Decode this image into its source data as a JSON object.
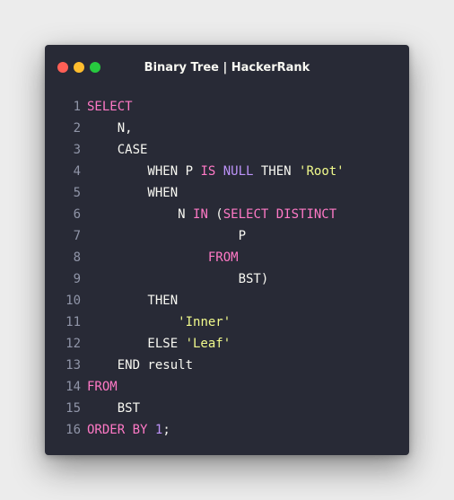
{
  "window": {
    "title": "Binary Tree | HackerRank",
    "colors": {
      "background": "#282a36",
      "keyword": "#ff79c6",
      "constant": "#bd93f9",
      "string": "#f1fa8c",
      "text": "#f8f8f2",
      "line_number": "#9095a8",
      "close": "#ff5f56",
      "minimize": "#ffbd2e",
      "maximize": "#27c93f"
    }
  },
  "code": {
    "lines": [
      {
        "n": "1",
        "tokens": [
          {
            "t": "SELECT",
            "k": "kw"
          }
        ]
      },
      {
        "n": "2",
        "tokens": [
          {
            "t": "    N,",
            "k": "plain"
          }
        ]
      },
      {
        "n": "3",
        "tokens": [
          {
            "t": "    CASE",
            "k": "plain"
          }
        ]
      },
      {
        "n": "4",
        "tokens": [
          {
            "t": "        WHEN P ",
            "k": "plain"
          },
          {
            "t": "IS",
            "k": "kw"
          },
          {
            "t": " ",
            "k": "plain"
          },
          {
            "t": "NULL",
            "k": "const"
          },
          {
            "t": " THEN ",
            "k": "plain"
          },
          {
            "t": "'Root'",
            "k": "str"
          }
        ]
      },
      {
        "n": "5",
        "tokens": [
          {
            "t": "        WHEN",
            "k": "plain"
          }
        ]
      },
      {
        "n": "6",
        "tokens": [
          {
            "t": "            N ",
            "k": "plain"
          },
          {
            "t": "IN",
            "k": "kw"
          },
          {
            "t": " (",
            "k": "plain"
          },
          {
            "t": "SELECT DISTINCT",
            "k": "kw"
          }
        ]
      },
      {
        "n": "7",
        "tokens": [
          {
            "t": "                    P",
            "k": "plain"
          }
        ]
      },
      {
        "n": "8",
        "tokens": [
          {
            "t": "                ",
            "k": "plain"
          },
          {
            "t": "FROM",
            "k": "kw"
          }
        ]
      },
      {
        "n": "9",
        "tokens": [
          {
            "t": "                    BST)",
            "k": "plain"
          }
        ]
      },
      {
        "n": "10",
        "tokens": [
          {
            "t": "        THEN",
            "k": "plain"
          }
        ]
      },
      {
        "n": "11",
        "tokens": [
          {
            "t": "            ",
            "k": "plain"
          },
          {
            "t": "'Inner'",
            "k": "str"
          }
        ]
      },
      {
        "n": "12",
        "tokens": [
          {
            "t": "        ELSE ",
            "k": "plain"
          },
          {
            "t": "'Leaf'",
            "k": "str"
          }
        ]
      },
      {
        "n": "13",
        "tokens": [
          {
            "t": "    END result",
            "k": "plain"
          }
        ]
      },
      {
        "n": "14",
        "tokens": [
          {
            "t": "FROM",
            "k": "kw"
          }
        ]
      },
      {
        "n": "15",
        "tokens": [
          {
            "t": "    BST",
            "k": "plain"
          }
        ]
      },
      {
        "n": "16",
        "tokens": [
          {
            "t": "ORDER BY",
            "k": "kw"
          },
          {
            "t": " ",
            "k": "plain"
          },
          {
            "t": "1",
            "k": "num"
          },
          {
            "t": ";",
            "k": "plain"
          }
        ]
      }
    ]
  }
}
